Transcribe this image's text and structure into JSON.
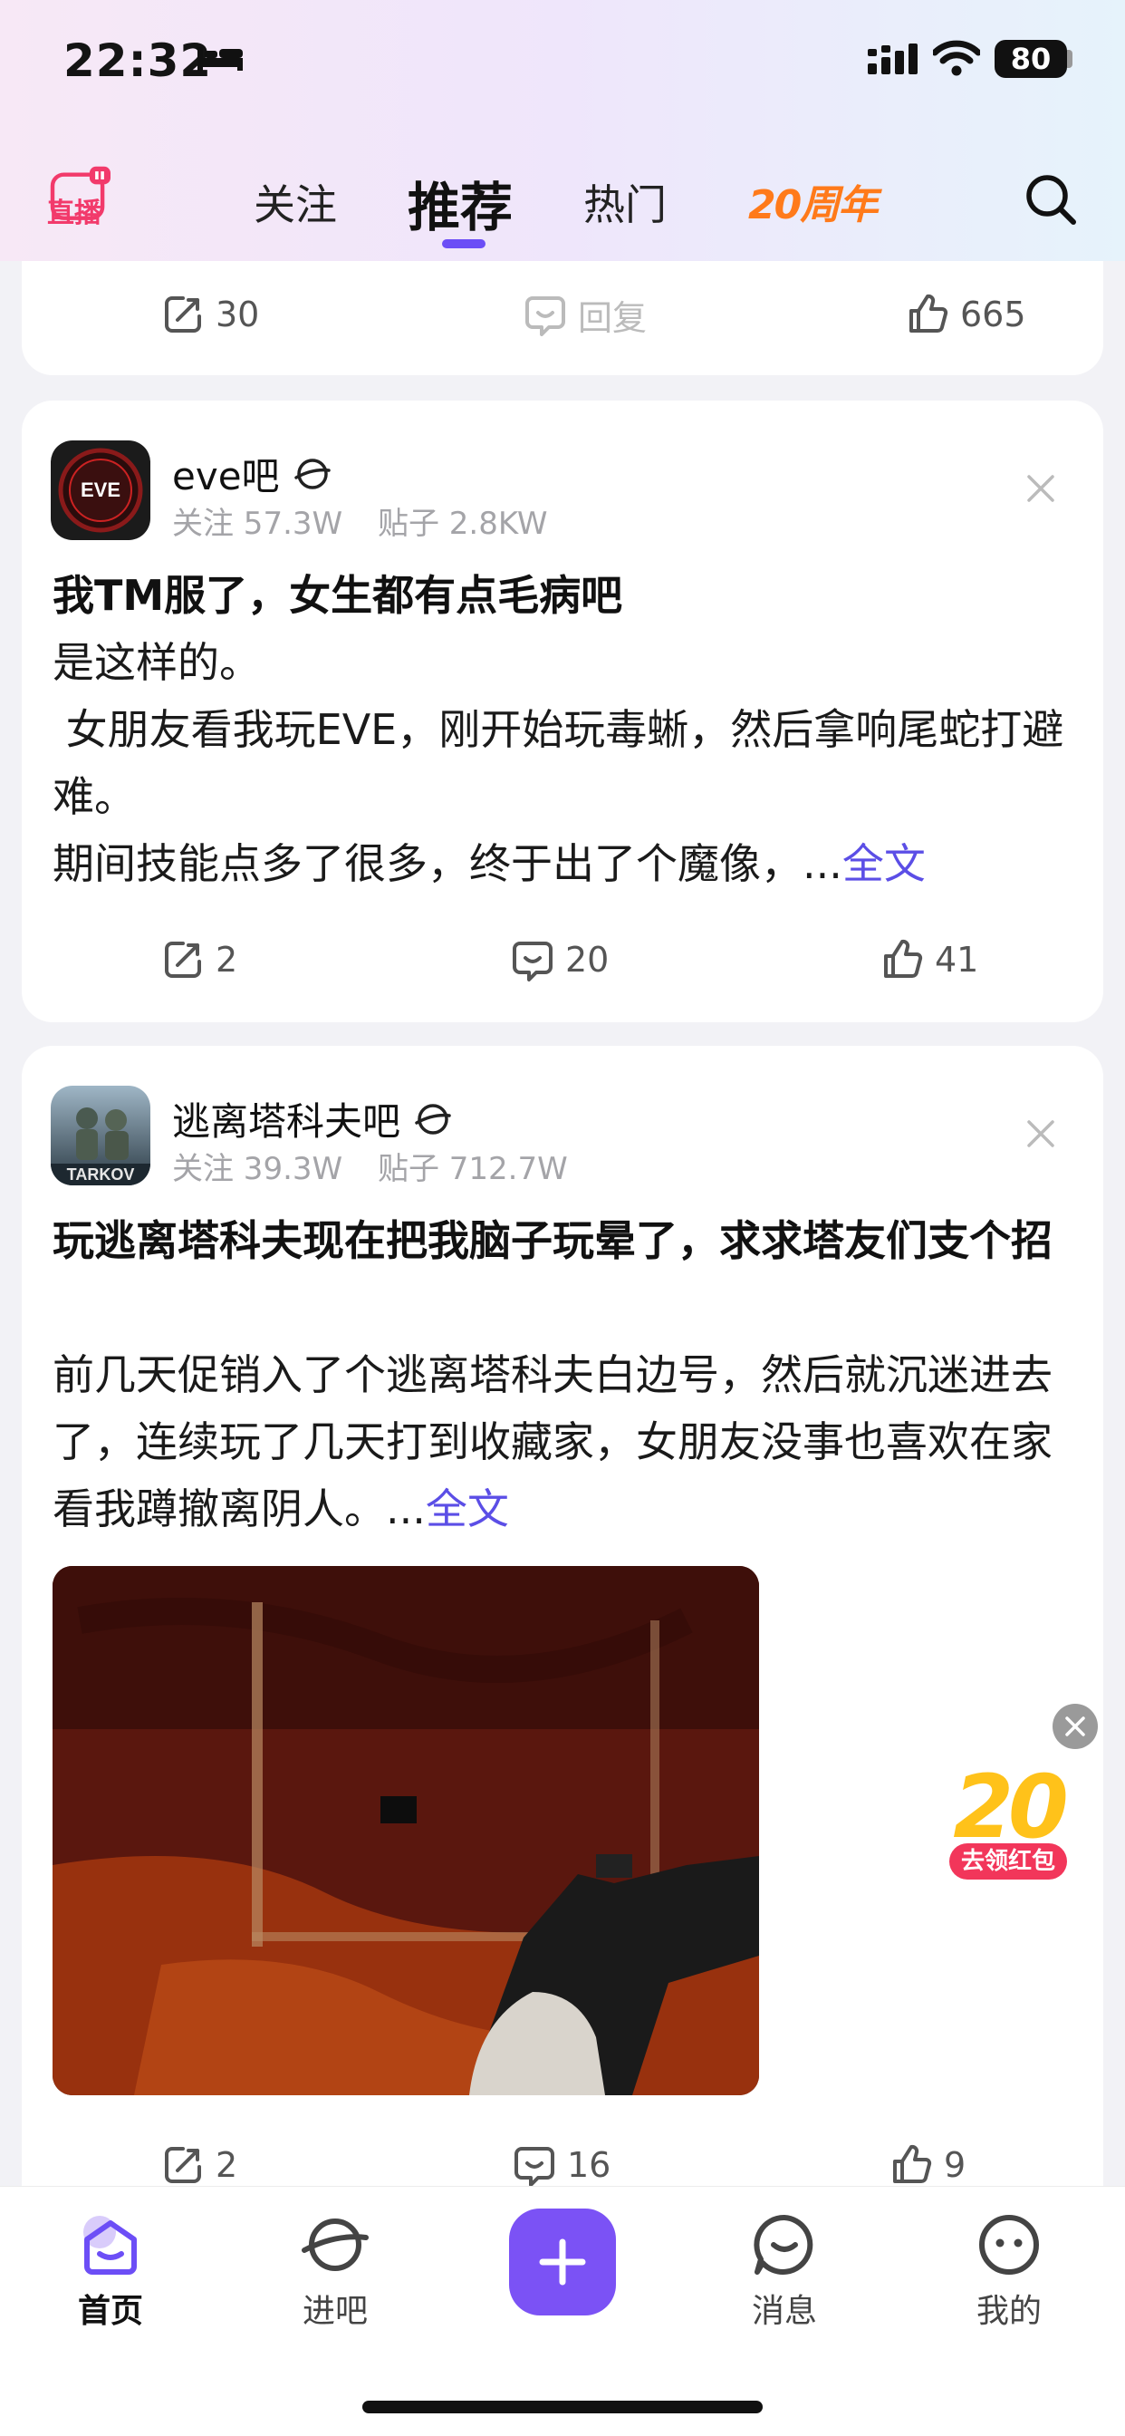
{
  "status_bar": {
    "time": "22:32",
    "battery": "80"
  },
  "nav": {
    "live_label": "直播",
    "tabs": [
      {
        "label": "关注",
        "active": false
      },
      {
        "label": "推荐",
        "active": true
      },
      {
        "label": "热门",
        "active": false
      }
    ],
    "anniversary": "20周年"
  },
  "prev_card": {
    "shares": "30",
    "reply_label": "回复",
    "likes": "665"
  },
  "posts": [
    {
      "forum": "eve吧",
      "follows": "关注 57.3W",
      "post_count": "贴子 2.8KW",
      "title": "我TM服了，女生都有点毛病吧",
      "body_lines": [
        "是这样的。",
        " 女朋友看我玩EVE，刚开始玩毒蜥，然后拿响尾蛇打避难。",
        "期间技能点多了很多，终于出了个魔像，..."
      ],
      "more": "全文",
      "shares": "2",
      "comments": "20",
      "likes": "41"
    },
    {
      "forum": "逃离塔科夫吧",
      "follows": "关注 39.3W",
      "post_count": "贴子 712.7W",
      "title": "玩逃离塔科夫现在把我脑子玩晕了，求求塔友们支个招",
      "body_lines": [
        "前几天促销入了个逃离塔科夫白边号，然后就沉迷进去了，连续玩了几天打到收藏家，女朋友没事也喜欢在家看我蹲撤离阴人。..."
      ],
      "more": "全文",
      "shares": "2",
      "comments": "16",
      "likes": "9"
    }
  ],
  "float_promo": {
    "number": "20",
    "label": "去领红包"
  },
  "tabbar": {
    "items": [
      {
        "label": "首页",
        "icon": "home-icon",
        "active": true
      },
      {
        "label": "进吧",
        "icon": "planet-icon",
        "active": false
      },
      {
        "label": "消息",
        "icon": "message-icon",
        "active": false
      },
      {
        "label": "我的",
        "icon": "profile-icon",
        "active": false
      }
    ]
  },
  "colors": {
    "accent": "#7b52f5",
    "link": "#5b4ee6",
    "live": "#f23a6b",
    "anniversary": "#ff7a1a"
  }
}
